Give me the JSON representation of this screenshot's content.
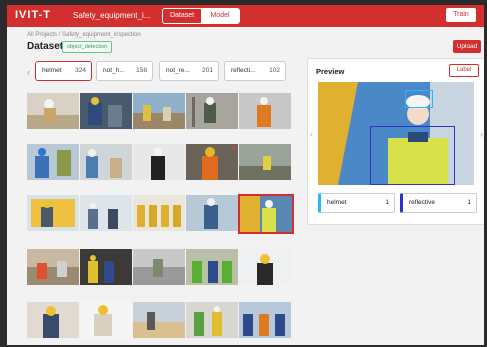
{
  "topbar": {
    "logo": "IVIT-T",
    "project_title": "Safety_equipment_i...",
    "tab_dataset": "Dataset",
    "tab_model": "Model",
    "train_label": "Train"
  },
  "breadcrumb": "All Projects / Safety_equipment_inspection",
  "dataset": {
    "title": "Dataset",
    "tag": "object_detection",
    "upload_label": "Upload"
  },
  "classes": [
    {
      "name": "helmet",
      "count": "324"
    },
    {
      "name": "not_h...",
      "count": "158"
    },
    {
      "name": "not_re...",
      "count": "201"
    },
    {
      "name": "reflecti...",
      "count": "102"
    }
  ],
  "preview": {
    "title": "Preview",
    "label_button": "Label",
    "legend": [
      {
        "name": "helmet",
        "count": "1",
        "color": "#29b6f6"
      },
      {
        "name": "reflective",
        "count": "1",
        "color": "#2a35c8"
      }
    ]
  },
  "colors": {
    "accent": "#d32f2f",
    "box_reflective": "#2a35c8",
    "box_helmet": "#29b6f6"
  },
  "thumbnails": [
    "worker-helmet-1",
    "worker-helmet-2",
    "construction-site-1",
    "worker-ladder-1",
    "worker-vest-1",
    "worker-blue-1",
    "worker-group-1",
    "worker-suit-1",
    "worker-orange-1",
    "worker-yellow-1",
    "worker-crane-1",
    "worker-team-1",
    "workers-group-2",
    "worker-tablet-1",
    "worker-reflective-1",
    "workers-team-2",
    "worker-vest-2",
    "site-scene-1",
    "workers-vests-1",
    "worker-woman-1",
    "worker-helmet-3",
    "worker-sitting-1",
    "worker-line-1",
    "worker-green-1",
    "workers-helmets-2"
  ]
}
